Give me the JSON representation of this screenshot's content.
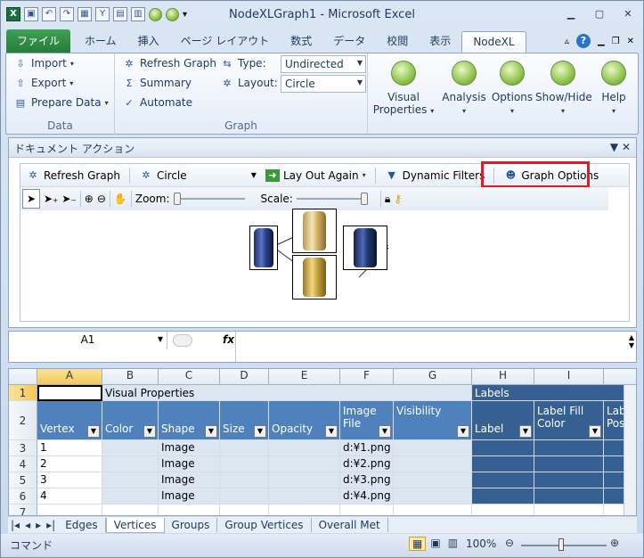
{
  "title": "NodeXLGraph1 - Microsoft Excel",
  "tabs": [
    "ファイル",
    "ホーム",
    "挿入",
    "ページ レイアウト",
    "数式",
    "データ",
    "校閲",
    "表示",
    "NodeXL"
  ],
  "ribbon": {
    "data_group": {
      "label": "Data",
      "import": "Import",
      "export": "Export",
      "prepare": "Prepare Data"
    },
    "graph_group": {
      "label": "Graph",
      "refresh": "Refresh Graph",
      "summary": "Summary",
      "automate": "Automate",
      "type_label": "Type:",
      "type_value": "Undirected",
      "layout_label": "Layout:",
      "layout_value": "Circle"
    },
    "visual_properties": "Visual Properties",
    "analysis": "Analysis",
    "options": "Options",
    "show_hide": "Show/Hide",
    "help": "Help"
  },
  "taskpane": {
    "title": "ドキュメント アクション",
    "refresh": "Refresh Graph",
    "layout": "Circle",
    "layout_again": "Lay Out Again",
    "dynamic_filters": "Dynamic Filters",
    "graph_options": "Graph Options",
    "zoom_label": "Zoom:",
    "scale_label": "Scale:",
    "zoom_level": 0.0,
    "scale_level": 1.0
  },
  "namebox": "A1",
  "fx": "fx",
  "columns": [
    "A",
    "B",
    "C",
    "D",
    "E",
    "F",
    "G",
    "H",
    "I"
  ],
  "row1": {
    "b": "Visual Properties",
    "h": "Labels"
  },
  "headers": [
    "Vertex",
    "Color",
    "Shape",
    "Size",
    "Opacity",
    "Image File",
    "Visibility",
    "Label",
    "Label Fill Color",
    "Label Position"
  ],
  "rows": [
    {
      "num": "3",
      "vertex": "1",
      "shape": "Image",
      "image": "d:¥1.png"
    },
    {
      "num": "4",
      "vertex": "2",
      "shape": "Image",
      "image": "d:¥2.png"
    },
    {
      "num": "5",
      "vertex": "3",
      "shape": "Image",
      "image": "d:¥3.png"
    },
    {
      "num": "6",
      "vertex": "4",
      "shape": "Image",
      "image": "d:¥4.png"
    }
  ],
  "row_numbers": [
    "1",
    "2",
    "3",
    "4",
    "5",
    "6",
    "7"
  ],
  "sheet_tabs": [
    "Edges",
    "Vertices",
    "Groups",
    "Group Vertices",
    "Overall Met"
  ],
  "status": {
    "mode": "コマンド",
    "zoom": "100%"
  }
}
